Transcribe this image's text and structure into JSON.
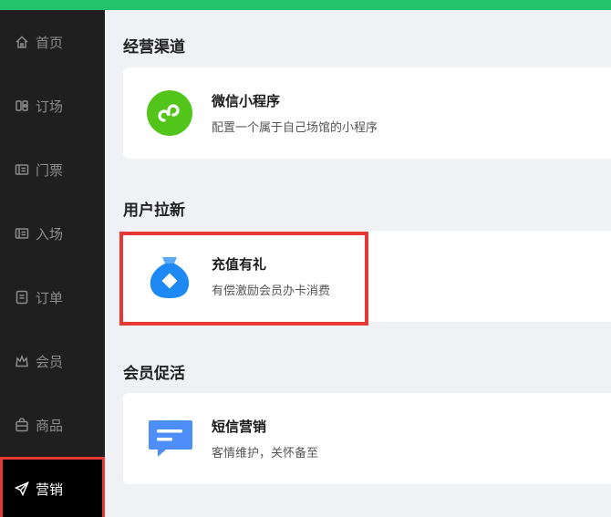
{
  "sidebar": {
    "items": [
      {
        "label": "首页",
        "icon": "home-icon"
      },
      {
        "label": "订场",
        "icon": "court-icon"
      },
      {
        "label": "门票",
        "icon": "ticket-icon"
      },
      {
        "label": "入场",
        "icon": "entry-icon"
      },
      {
        "label": "订单",
        "icon": "order-icon"
      },
      {
        "label": "会员",
        "icon": "member-icon"
      },
      {
        "label": "商品",
        "icon": "goods-icon"
      },
      {
        "label": "营销",
        "icon": "marketing-icon"
      }
    ],
    "active_index": 7
  },
  "sections": [
    {
      "title": "经营渠道",
      "cards": [
        {
          "name": "微信小程序",
          "desc": "配置一个属于自己场馆的小程序",
          "icon": "mini-program-icon",
          "color": "#52c41a"
        }
      ]
    },
    {
      "title": "用户拉新",
      "cards": [
        {
          "name": "充值有礼",
          "desc": "有偿激励会员办卡消费",
          "icon": "money-bag-icon",
          "color": "#1e88f5"
        }
      ]
    },
    {
      "title": "会员促活",
      "cards": [
        {
          "name": "短信营销",
          "desc": "客情维护，关怀备至",
          "icon": "sms-icon",
          "color": "#4d8ef8"
        }
      ]
    }
  ],
  "colors": {
    "topbar": "#22c36b",
    "sidebar_bg": "#1f1f1f",
    "highlight": "#e53935"
  }
}
